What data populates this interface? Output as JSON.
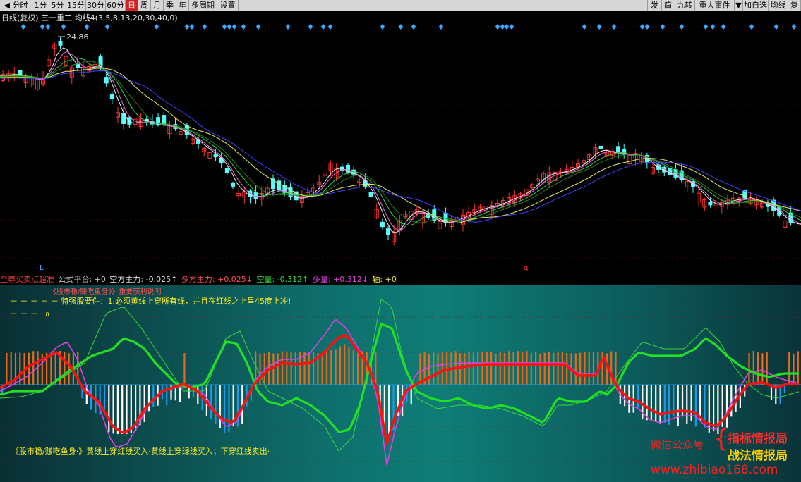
{
  "toolbar": {
    "left": [
      {
        "label": "◀ 分时",
        "active": false
      },
      {
        "label": "1分",
        "active": false
      },
      {
        "label": "5分",
        "active": false
      },
      {
        "label": "15分",
        "active": false
      },
      {
        "label": "30分",
        "active": false
      },
      {
        "label": "60分",
        "active": false
      },
      {
        "label": "日",
        "active": true
      },
      {
        "label": "周",
        "active": false
      },
      {
        "label": "月",
        "active": false
      },
      {
        "label": "季",
        "active": false
      },
      {
        "label": "年",
        "active": false
      },
      {
        "label": "多周期",
        "active": false
      },
      {
        "label": "设置",
        "active": false
      }
    ],
    "right": [
      {
        "label": "发",
        "active": false
      },
      {
        "label": "简",
        "active": false
      },
      {
        "label": "九转",
        "active": false
      },
      {
        "label": "重大事件",
        "active": false
      },
      {
        "label": "▼",
        "active": false
      },
      {
        "label": "加自选",
        "active": false
      },
      {
        "label": "均线",
        "active": false
      },
      {
        "label": "复",
        "active": false
      }
    ]
  },
  "upper_chart": {
    "period_label": "日线(复权)",
    "stock_name": "三一重工",
    "ma_label": "均线4(3,5,8,13,20,30,40,0)",
    "high_price_label": "24.86",
    "low_marker_label": "L",
    "q_marker_label": "q",
    "colors": {
      "up": "#ff3333",
      "down": "#54ffff",
      "ma_white": "#f0f0f0",
      "ma_yellow": "#e8e860",
      "ma_green": "#30d030",
      "ma_blue": "#4040ff",
      "diamond": "#3aa8ff"
    }
  },
  "indicator_bar": {
    "name": "至尊买卖点超准",
    "platform": "公式平台: +0",
    "kong_main": "空方主力: -0.025↑",
    "duo_main": "多方主力: +0.025↓",
    "kong_liang": "空量: -0.312↑",
    "duo_liang": "多量: +0.312↓",
    "zhou": "轴: +0"
  },
  "lower_chart": {
    "header_line": "《股市稳/赚吃鱼身》》重要获利说明",
    "requirement": "特强股要件：1.必须黄线上穿所有线，并且在红线之上呈45度上冲!",
    "zero_marker": "0",
    "footer": "《股市稳/赚吃鱼身·》黄线上穿红线买入·黄线上穿绿线买入；下穿红线卖出·",
    "colors": {
      "red": "#ff1010",
      "green": "#22e022",
      "magenta": "#e040e0",
      "bar_up": "#e86a1a",
      "bar_down": "#1a9ae8",
      "bar_white": "#ffffff"
    }
  },
  "watermark": {
    "wechat": "微信公众号",
    "brace": "{",
    "name1": "指标情报局",
    "name2": "战法情报局",
    "url": "www.zhibiao168.com"
  }
}
